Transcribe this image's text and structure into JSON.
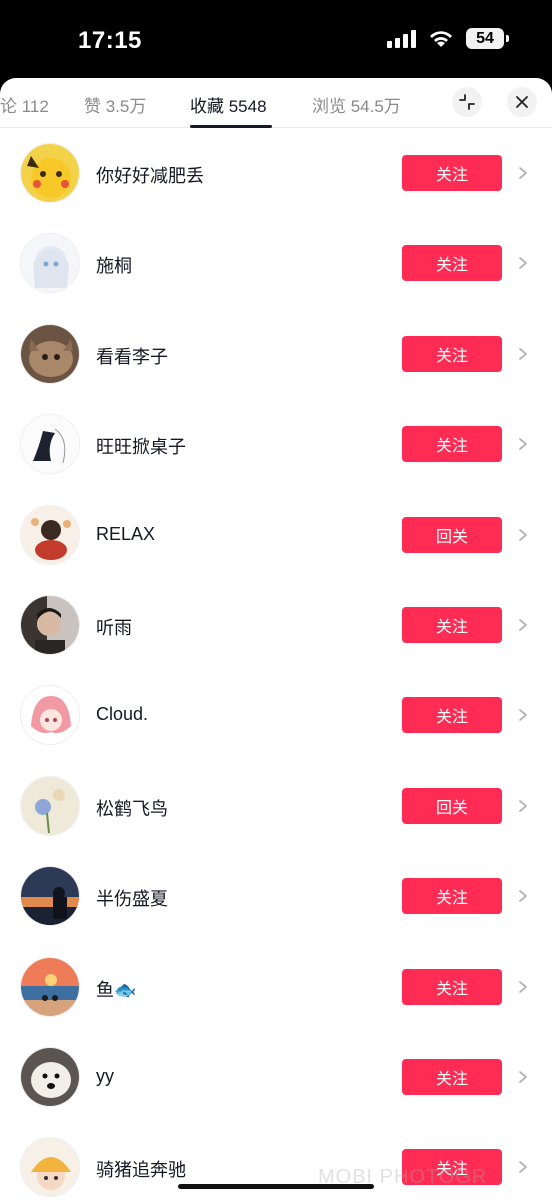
{
  "status_bar": {
    "time": "17:15",
    "battery": "54"
  },
  "tabs": [
    {
      "label": "论 112",
      "active": false
    },
    {
      "label": "赞 3.5万",
      "active": false
    },
    {
      "label": "收藏 5548",
      "active": true
    },
    {
      "label": "浏览 54.5万",
      "active": false
    }
  ],
  "header_icons": {
    "collapse": "collapse-icon",
    "close": "close-icon"
  },
  "users": [
    {
      "name": "你好好减肥丢",
      "button": "关注",
      "avatar": "yellow-cartoon"
    },
    {
      "name": "施桐",
      "button": "关注",
      "avatar": "anime-girl-white"
    },
    {
      "name": "看看李子",
      "button": "关注",
      "avatar": "cat-photo"
    },
    {
      "name": "旺旺掀桌子",
      "button": "关注",
      "avatar": "sketch-drawing"
    },
    {
      "name": "RELAX",
      "button": "回关",
      "avatar": "food-cartoon"
    },
    {
      "name": "听雨",
      "button": "关注",
      "avatar": "portrait-photo"
    },
    {
      "name": "Cloud.",
      "button": "关注",
      "avatar": "pink-anime"
    },
    {
      "name": "松鹤飞鸟",
      "button": "回关",
      "avatar": "flower-painting"
    },
    {
      "name": "半伤盛夏",
      "button": "关注",
      "avatar": "sunset-silhouette"
    },
    {
      "name": "鱼🐟",
      "button": "关注",
      "avatar": "beach-sunset"
    },
    {
      "name": "yy",
      "button": "关注",
      "avatar": "dog-photo"
    },
    {
      "name": "骑猪追奔驰",
      "button": "关注",
      "avatar": "girl-cartoon-hat"
    }
  ],
  "watermark": "MOBI PHOTOGR",
  "colors": {
    "accent": "#fe2c55",
    "text": "#161823",
    "muted": "#8a8a8a"
  }
}
